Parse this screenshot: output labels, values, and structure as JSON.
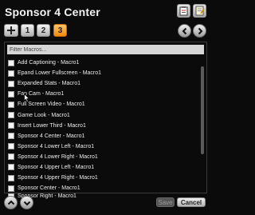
{
  "window": {
    "title": "Sponsor 4 Center"
  },
  "header_icons": [
    "clipboard-icon",
    "notes-icon"
  ],
  "toolbar": {
    "add_icon": "plus-icon",
    "tabs": [
      "1",
      "2",
      "3"
    ],
    "active_tab": "3",
    "nav": [
      "back-arrow-icon",
      "forward-arrow-icon"
    ]
  },
  "filter": {
    "placeholder": "Filter Macros..."
  },
  "macros": [
    "Add Captioning - Macro1",
    "Epand Lower Fullscreen - Macro1",
    "Expanded Stats - Macro1",
    "Fan Cam - Macro1",
    "Full Screen Video - Macro1",
    "Game Look - Macro1",
    "Insert Lower Third - Macro1",
    "Sponsor 4 Center - Macro1",
    "Sponsor 4 Lower Left - Macro1",
    "Sponsor 4 Lower Right - Macro1",
    "Sponsor 4 Upper Left - Macro1",
    "Sponsor 4 Upper Right - Macro1",
    "Sponsor Center - Macro1",
    "Sponsor Right - Macro1"
  ],
  "footer": {
    "save_label": "Save",
    "cancel_label": "Cancel"
  },
  "colors": {
    "active_tab": "#f08a10",
    "background": "#0b0b0b"
  }
}
